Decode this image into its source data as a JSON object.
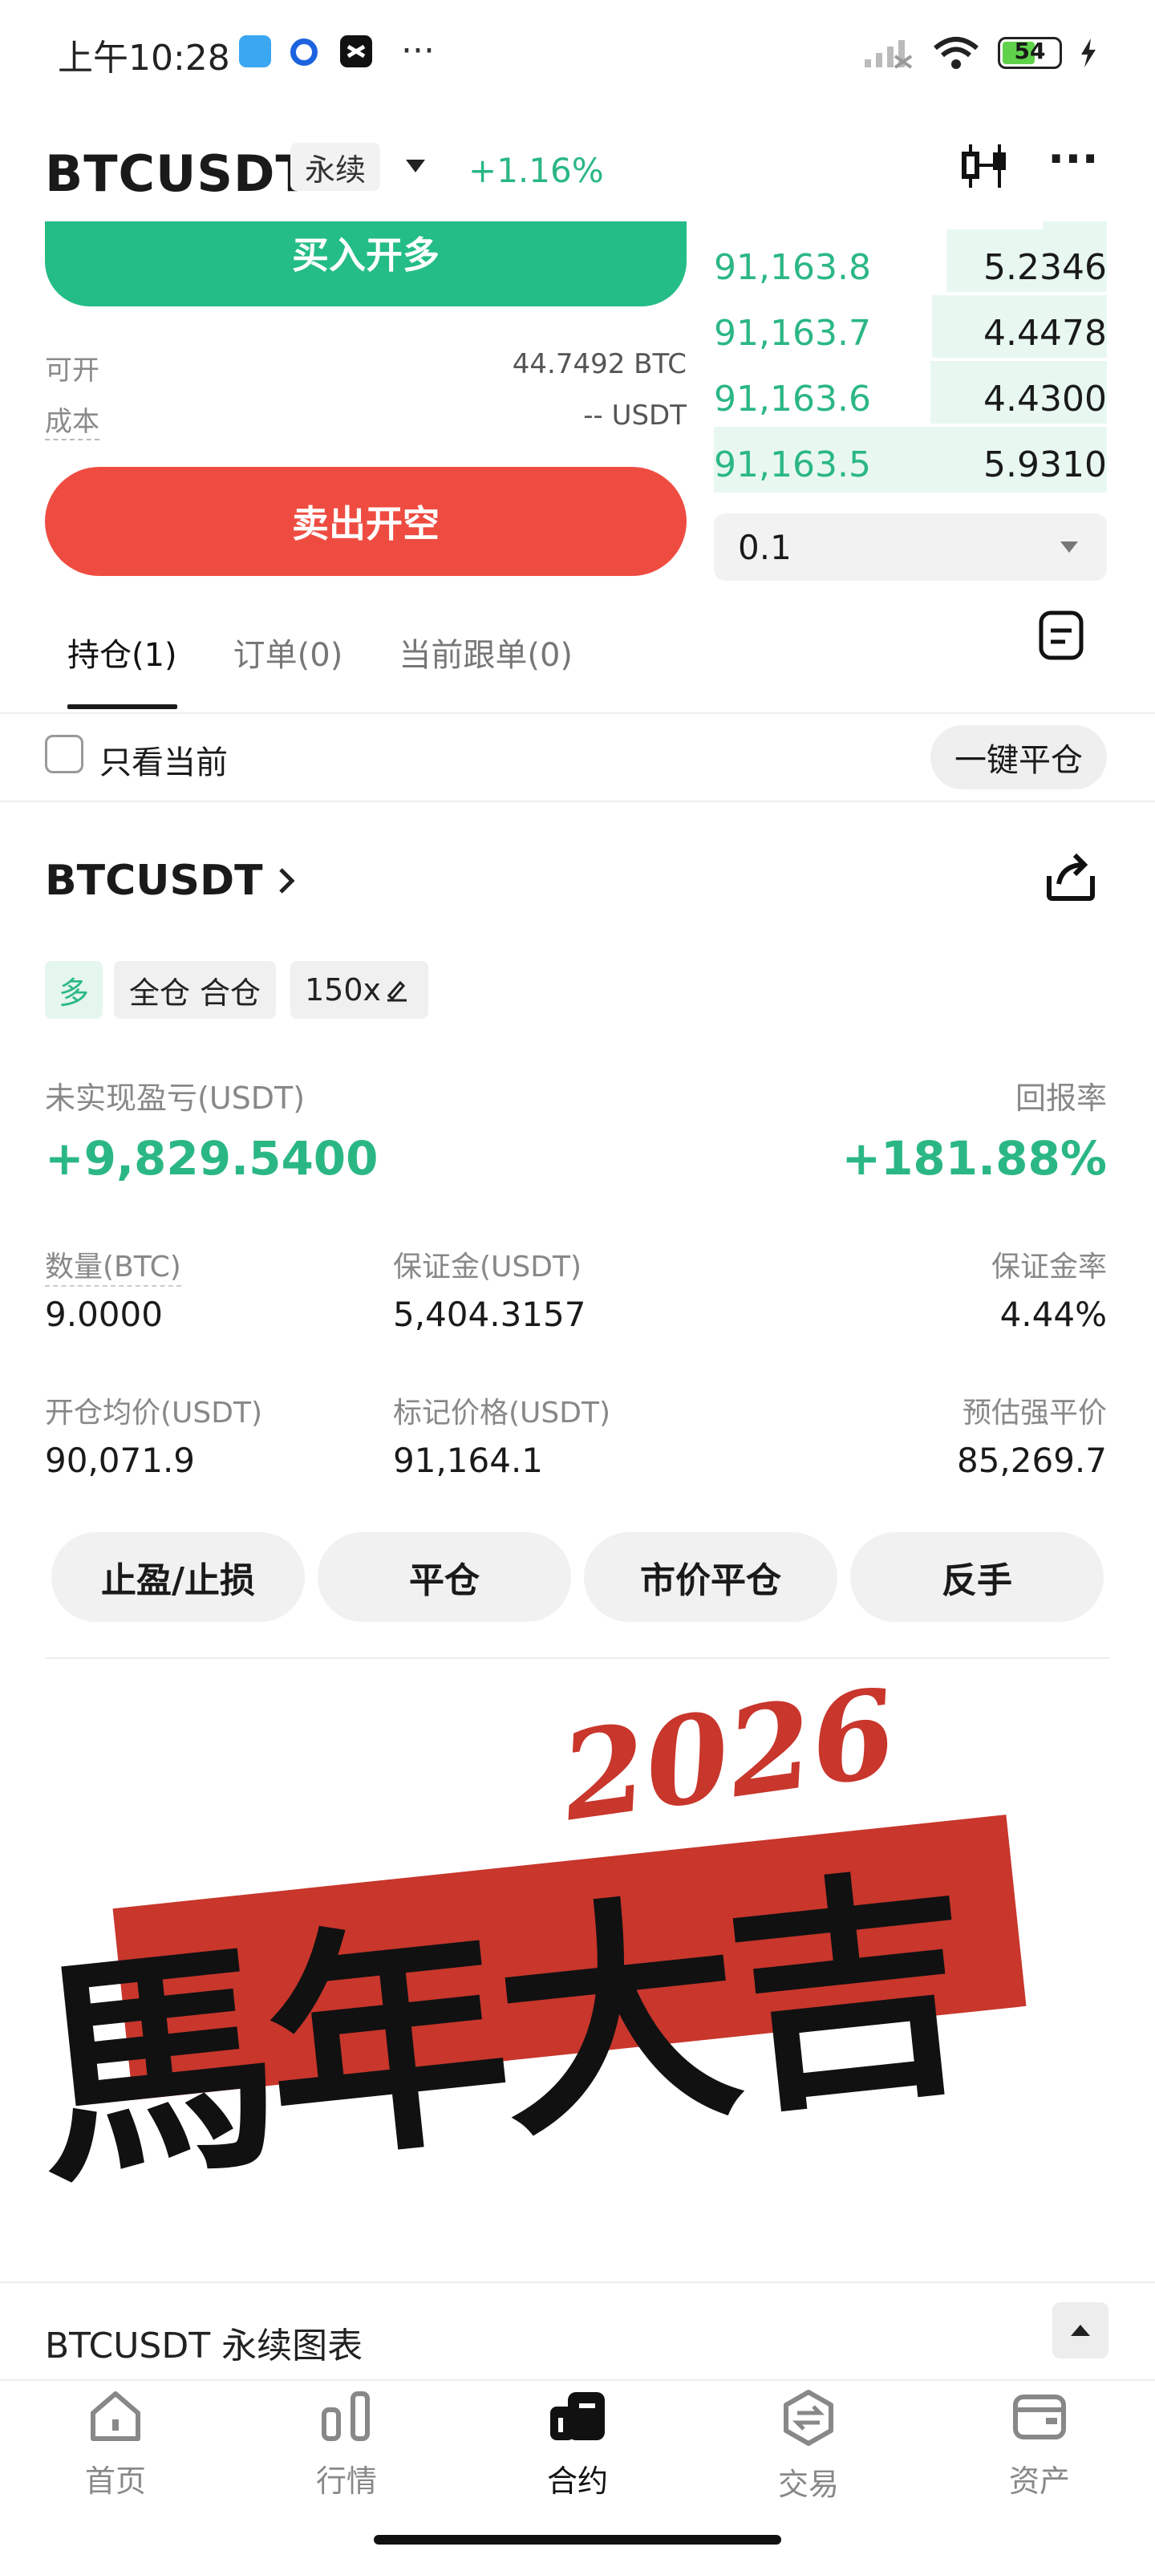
{
  "status_bar": {
    "time": "上午10:28",
    "battery": "54"
  },
  "header": {
    "symbol": "BTCUSDT",
    "contract_type": "永续",
    "change": "+1.16%"
  },
  "trade": {
    "buy_label": "买入开多",
    "sell_label": "卖出开空",
    "available_label": "可开",
    "available_value": "44.7492 BTC",
    "cost_label": "成本",
    "cost_value": "-- USDT"
  },
  "orderbook": {
    "rows": [
      {
        "price": "91,163.8",
        "qty": "5.2346"
      },
      {
        "price": "91,163.7",
        "qty": "4.4478"
      },
      {
        "price": "91,163.6",
        "qty": "4.4300"
      },
      {
        "price": "91,163.5",
        "qty": "5.9310"
      }
    ],
    "qty_select": "0.1"
  },
  "tabs": [
    {
      "label": "持仓(1)"
    },
    {
      "label": "订单(0)"
    },
    {
      "label": "当前跟单(0)"
    }
  ],
  "filter": {
    "only_current": "只看当前",
    "close_all": "一键平仓"
  },
  "position": {
    "symbol": "BTCUSDT",
    "side": "多",
    "margin_mode": "全仓 合仓",
    "leverage": "150x",
    "pnl_label": "未实现盈亏(USDT)",
    "pnl_value": "+9,829.5400",
    "roe_label": "回报率",
    "roe_value": "+181.88%",
    "qty_label": "数量(BTC)",
    "qty_value": "9.0000",
    "margin_label": "保证金(USDT)",
    "margin_value": "5,404.3157",
    "margin_ratio_label": "保证金率",
    "margin_ratio_value": "4.44%",
    "entry_label": "开仓均价(USDT)",
    "entry_value": "90,071.9",
    "mark_label": "标记价格(USDT)",
    "mark_value": "91,164.1",
    "liq_label": "预估强平价",
    "liq_value": "85,269.7",
    "actions": [
      "止盈/止损",
      "平仓",
      "市价平仓",
      "反手"
    ]
  },
  "banner": {
    "year": "2026",
    "text": "馬年大吉"
  },
  "chart_section": {
    "title": "BTCUSDT 永续图表"
  },
  "bottom_nav": [
    {
      "label": "首页",
      "icon": "home-icon"
    },
    {
      "label": "行情",
      "icon": "market-icon"
    },
    {
      "label": "合约",
      "icon": "contract-icon"
    },
    {
      "label": "交易",
      "icon": "exchange-icon"
    },
    {
      "label": "资产",
      "icon": "wallet-icon"
    }
  ],
  "colors": {
    "green": "#2bb784",
    "buy": "#24bd85",
    "sell": "#ef4c41",
    "banner_red": "#c8362c"
  }
}
